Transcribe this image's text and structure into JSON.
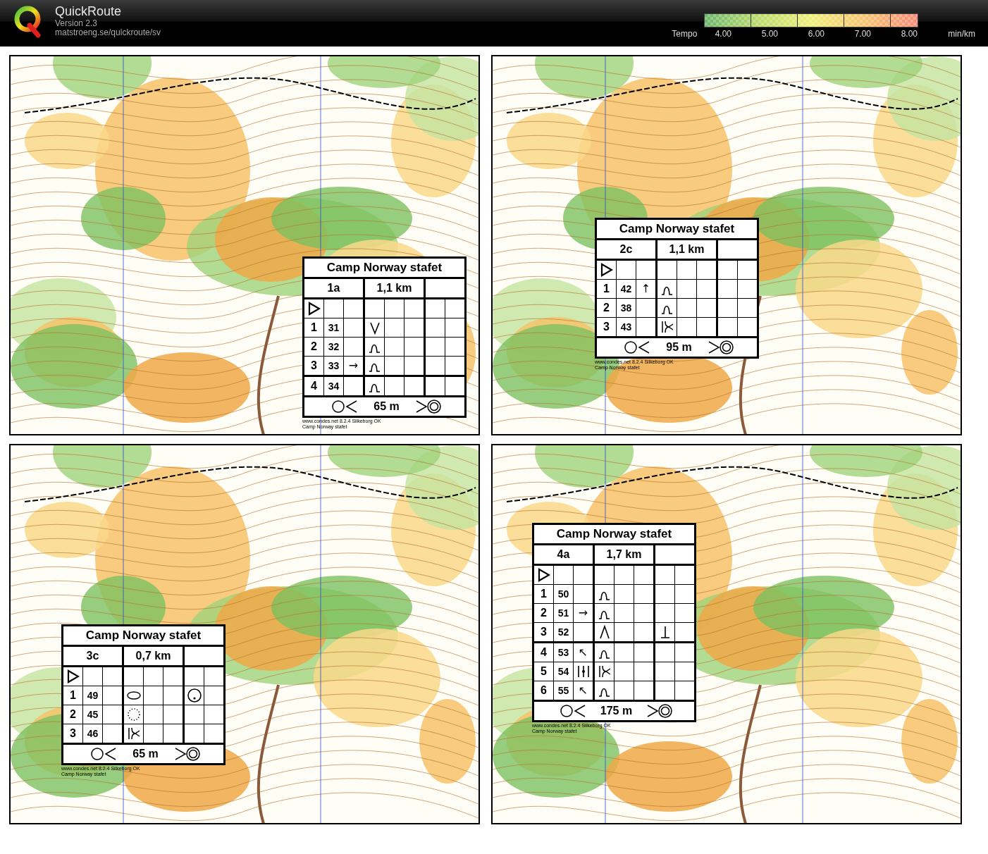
{
  "app": {
    "title": "QuickRoute",
    "version": "Version 2.3",
    "url": "matstroeng.se/quickroute/sv"
  },
  "tempo_legend": {
    "label": "Tempo",
    "ticks": [
      "4.00",
      "5.00",
      "6.00",
      "7.00",
      "8.00"
    ],
    "unit": "min/km"
  },
  "panels": [
    {
      "card": {
        "title": "Camp Norway stafet",
        "course": "1a",
        "length": "1,1 km",
        "controls": [
          {
            "number": "1",
            "code": "31",
            "feature": {
              "kind": "v-shape"
            }
          },
          {
            "number": "2",
            "code": "32",
            "feature": {
              "kind": "knoll-curve"
            }
          },
          {
            "number": "3",
            "code": "33",
            "direction": "→",
            "feature": {
              "kind": "knoll-curve"
            }
          },
          {
            "number": "4",
            "code": "34",
            "feature": {
              "kind": "knoll-curve"
            }
          }
        ],
        "finish_distance": "65 m",
        "footer": [
          "www.condes.net 8.2.4 Silkeborg OK",
          "Camp Norway stafet"
        ]
      }
    },
    {
      "card": {
        "title": "Camp Norway stafet",
        "course": "2c",
        "length": "1,1 km",
        "controls": [
          {
            "number": "1",
            "code": "42",
            "direction": "↑",
            "feature": {
              "kind": "knoll-curve"
            }
          },
          {
            "number": "2",
            "code": "38",
            "feature": {
              "kind": "knoll-curve"
            }
          },
          {
            "number": "3",
            "code": "43",
            "feature": {
              "kind": "branch"
            }
          }
        ],
        "finish_distance": "95 m",
        "footer": [
          "www.condes.net 8.2.4 Silkeborg OK",
          "Camp Norway stafet"
        ]
      }
    },
    {
      "card": {
        "title": "Camp Norway stafet",
        "course": "3c",
        "length": "0,7 km",
        "controls": [
          {
            "number": "1",
            "code": "49",
            "feature": {
              "kind": "ellipse"
            },
            "extra": {
              "kind": "dot-in-circle"
            }
          },
          {
            "number": "2",
            "code": "45",
            "feature": {
              "kind": "dotted-circle"
            }
          },
          {
            "number": "3",
            "code": "46",
            "feature": {
              "kind": "branch"
            }
          }
        ],
        "finish_distance": "65 m",
        "footer": [
          "www.condes.net 8.2.4 Silkeborg OK",
          "Camp Norway stafet"
        ]
      }
    },
    {
      "card": {
        "title": "Camp Norway stafet",
        "course": "4a",
        "length": "1,7 km",
        "controls": [
          {
            "number": "1",
            "code": "50",
            "feature": {
              "kind": "knoll-curve"
            }
          },
          {
            "number": "2",
            "code": "51",
            "direction": "→",
            "feature": {
              "kind": "knoll-curve"
            }
          },
          {
            "number": "3",
            "code": "52",
            "feature": {
              "kind": "caret"
            },
            "extra": {
              "kind": "t-bar"
            }
          },
          {
            "number": "4",
            "code": "53",
            "direction": "↖",
            "feature": {
              "kind": "knoll-curve"
            }
          },
          {
            "number": "5",
            "code": "54",
            "position": {
              "kind": "between-bars"
            },
            "feature": {
              "kind": "branch"
            }
          },
          {
            "number": "6",
            "code": "55",
            "direction": "↖",
            "feature": {
              "kind": "knoll-curve"
            }
          }
        ],
        "finish_distance": "175 m",
        "footer": [
          "www.condes.net 8.2.4 Silkeborg OK",
          "Camp Norway stafet"
        ]
      }
    }
  ]
}
